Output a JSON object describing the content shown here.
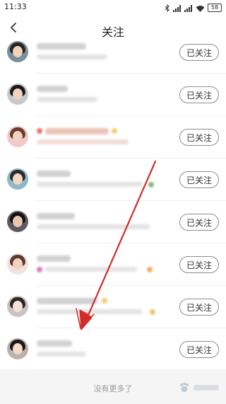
{
  "status_bar": {
    "time": "11:33",
    "battery": "58",
    "icons": [
      "bluetooth-icon",
      "signal-icon",
      "signal-icon",
      "wifi-icon",
      "battery-icon"
    ]
  },
  "nav": {
    "title": "关注",
    "back_icon": "chevron-left-icon"
  },
  "follow_list": [
    {
      "button_label": "已关注"
    },
    {
      "button_label": "已关注"
    },
    {
      "button_label": "已关注"
    },
    {
      "button_label": "已关注"
    },
    {
      "button_label": "已关注"
    },
    {
      "button_label": "已关注"
    },
    {
      "button_label": "已关注"
    },
    {
      "button_label": "已关注"
    }
  ],
  "footer": {
    "end_text": "没有更多了"
  },
  "annotation": {
    "arrow_color": "#d42b2b"
  },
  "colors": {
    "accent": "#d42b2b",
    "button_border": "#8c8c8c",
    "footer_bg": "#f5f5f5"
  }
}
